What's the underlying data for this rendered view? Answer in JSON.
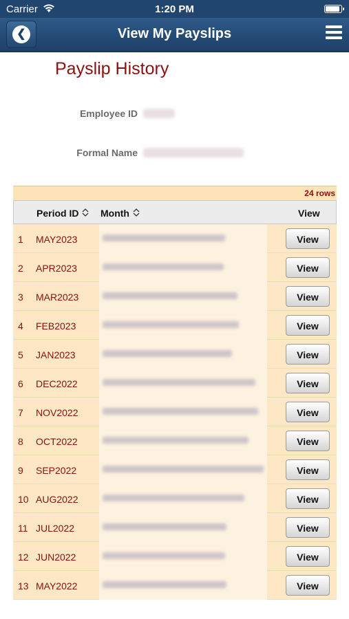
{
  "status_bar": {
    "carrier": "Carrier",
    "time": "1:20 PM",
    "wifi_icon": "wifi-icon",
    "battery_icon": "battery-icon"
  },
  "nav": {
    "title": "View My Payslips",
    "back_icon": "back-icon",
    "menu_icon": "hamburger-menu-icon"
  },
  "page": {
    "title": "Payslip History",
    "employee_id_label": "Employee ID",
    "formal_name_label": "Formal Name"
  },
  "grid": {
    "row_count": "24 rows",
    "headers": {
      "period": "Period ID",
      "month": "Month",
      "view": "View"
    },
    "view_label": "View",
    "rows": [
      {
        "num": "1",
        "period": "MAY2023"
      },
      {
        "num": "2",
        "period": "APR2023"
      },
      {
        "num": "3",
        "period": "MAR2023"
      },
      {
        "num": "4",
        "period": "FEB2023"
      },
      {
        "num": "5",
        "period": "JAN2023"
      },
      {
        "num": "6",
        "period": "DEC2022"
      },
      {
        "num": "7",
        "period": "NOV2022"
      },
      {
        "num": "8",
        "period": "OCT2022"
      },
      {
        "num": "9",
        "period": "SEP2022"
      },
      {
        "num": "10",
        "period": "AUG2022"
      },
      {
        "num": "11",
        "period": "JUL2022"
      },
      {
        "num": "12",
        "period": "JUN2022"
      },
      {
        "num": "13",
        "period": "MAY2022"
      }
    ]
  }
}
